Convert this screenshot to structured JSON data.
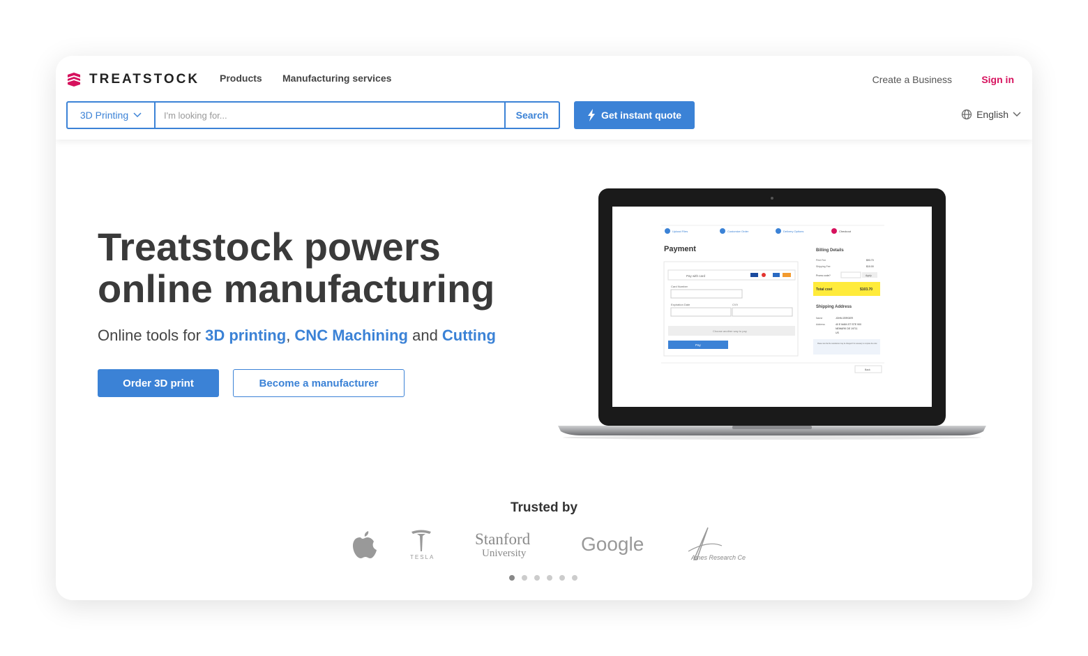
{
  "brand": {
    "name": "TREATSTOCK",
    "accent": "#d6115d",
    "primary": "#3b82d6"
  },
  "nav": {
    "products": "Products",
    "manufacturing": "Manufacturing services",
    "create_business": "Create a Business",
    "sign_in": "Sign in"
  },
  "search": {
    "category": "3D Printing",
    "placeholder": "I'm looking for...",
    "button": "Search"
  },
  "quote_button": "Get instant quote",
  "language": "English",
  "hero": {
    "title_line1": "Treatstock powers",
    "title_line2": "online manufacturing",
    "sub_prefix": "Online tools for ",
    "sub_link1": "3D printing",
    "sub_sep": ", ",
    "sub_link2": "CNC Machining",
    "sub_and": " and ",
    "sub_link3": "Cutting",
    "btn_order": "Order 3D print",
    "btn_manufacturer": "Become a manufacturer"
  },
  "screen": {
    "steps": [
      "Upload Files",
      "Customize Order",
      "Delivery Options",
      "Checkout"
    ],
    "payment_title": "Payment",
    "pay_with_card": "Pay with card",
    "card_number": "Card Number",
    "expiration": "Expiration Date",
    "cvv": "CVV",
    "choose_another": "Choose another way to pay",
    "pay": "Pay",
    "billing_title": "Billing Details",
    "print_fee": "Print Fee",
    "print_fee_val": "$93.70",
    "shipping_fee": "Shipping Fee",
    "shipping_fee_val": "$10.00",
    "promo": "Promo code?",
    "apply": "Apply",
    "total_label": "Total cost",
    "total_val": "$103.70",
    "shipping_title": "Shipping Address",
    "name_label": "Name",
    "name_val": "JOHN ZERGER",
    "address_label": "Address",
    "address_val": "40 E MAIN ST STE 900",
    "address_val2": "NEWARK DE 19711",
    "address_val3": "US",
    "note": "Please note that the manufacturer may be changed if it's necessary to complete the order.",
    "back": "Back"
  },
  "trusted": {
    "title": "Trusted by",
    "tesla": "TESLA",
    "stanford1": "Stanford",
    "stanford2": "University",
    "google": "Google",
    "ames": "Ames Research Ce"
  },
  "carousel": {
    "count": 6,
    "active": 1
  }
}
